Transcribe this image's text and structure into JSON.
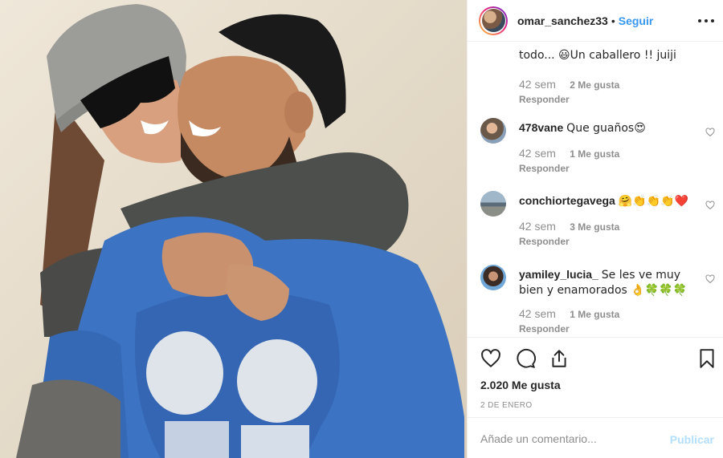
{
  "post": {
    "author": "omar_sanchez33",
    "separator": "•",
    "follow_label": "Seguir"
  },
  "comments": [
    {
      "user": "",
      "text": "todo... 😃Un caballero !! juiji",
      "time": "42 sem",
      "likes": "2 Me gusta",
      "reply": "Responder"
    },
    {
      "user": "478vane",
      "text": "Que guaños😍",
      "time": "42 sem",
      "likes": "1 Me gusta",
      "reply": "Responder"
    },
    {
      "user": "conchiortegavega",
      "text": "🤗👏👏👏❤️",
      "time": "42 sem",
      "likes": "3 Me gusta",
      "reply": "Responder"
    },
    {
      "user": "yamiley_lucia_",
      "text": "Se les ve muy bien y enamorados 👌🍀🍀🍀",
      "time": "42 sem",
      "likes": "1 Me gusta",
      "reply": "Responder"
    }
  ],
  "stats": {
    "likes_total": "2.020 Me gusta",
    "date": "2 DE ENERO"
  },
  "composer": {
    "placeholder": "Añade un comentario...",
    "publish_label": "Publicar"
  },
  "icons": [
    "photo",
    "avatar",
    "more-options-icon",
    "heart-icon",
    "comment-icon",
    "share-icon",
    "bookmark-icon"
  ],
  "colors": {
    "link": "#3897f0",
    "secondary_text": "#8e8e8e",
    "publish_disabled": "#b2dffc",
    "border": "#efefef"
  }
}
